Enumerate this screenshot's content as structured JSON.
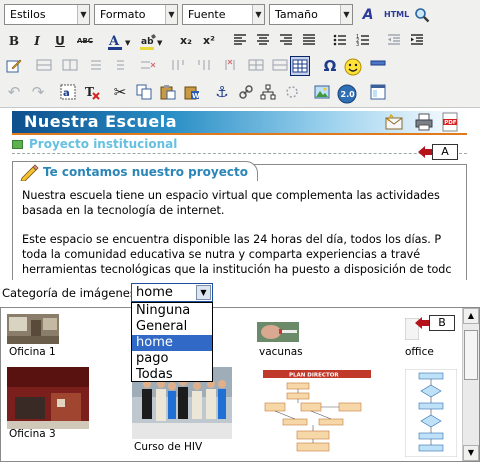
{
  "toolbar": {
    "styles_select": "Estilos",
    "format_select": "Formato",
    "font_select": "Fuente",
    "size_select": "Tamaño",
    "html_label": "HTML",
    "bold": "B",
    "italic": "I",
    "underline": "U",
    "strike": "ABC",
    "subscript": "x₂",
    "superscript": "x²",
    "omega": "Ω",
    "smiley": "☺",
    "tt_badge": "2.0"
  },
  "content": {
    "banner_title": "Nuestra Escuela",
    "subheading": "Proyecto institucional",
    "tab_title": "Te contamos nuestro proyecto",
    "callout_a": "A",
    "paragraph1_line1": "Nuestra escuela tiene un espacio virtual que complementa las actividades",
    "paragraph1_line2": "basada en la tecnología de internet.",
    "paragraph2_line1": "Este espacio se encuentra disponible las 24 horas del día, todos los días. P",
    "paragraph2_line2": "toda la comunidad educativa se nutra y comparta experiencias a travé",
    "paragraph2_line3": "herramientas tecnológicas que la institución ha puesto a disposición de todc"
  },
  "image_picker": {
    "category_label": "Categoría de imágenes:",
    "selected_category": "home",
    "options": [
      "Ninguna",
      "General",
      "home",
      "pago",
      "Todas"
    ],
    "callout_b": "B",
    "images": [
      {
        "caption": "Oficina 1"
      },
      {
        "caption": ""
      },
      {
        "caption": "vacunas"
      },
      {
        "caption": "office"
      },
      {
        "caption": "Oficina 3"
      },
      {
        "caption": "Curso de HIV"
      },
      {
        "caption": ""
      },
      {
        "caption": ""
      }
    ],
    "flowchart_title": "PLAN DIRECTOR"
  },
  "colors": {
    "banner_start": "#0d4f8d",
    "banner_rule": "#e07a1c",
    "subheading": "#66c0e0",
    "tab_title": "#2b86b8",
    "selection": "#3169c6",
    "callout_arrow": "#b5121b"
  }
}
